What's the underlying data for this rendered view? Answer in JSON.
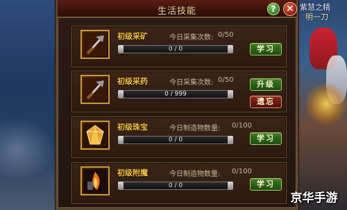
{
  "window": {
    "title": "生活技能",
    "help_label": "?",
    "close_label": "✕"
  },
  "background": {
    "npc_title": "紫慧之精",
    "npc_name": "明一刀"
  },
  "skills": [
    {
      "name": "初级采矿",
      "icon": "pickaxe-icon",
      "count_label": "今日采集次数:",
      "count_value": "0/50",
      "progress_text": "0 / 0",
      "progress": 0,
      "buttons": [
        {
          "label": "学习",
          "kind": "learn"
        }
      ]
    },
    {
      "name": "初级采药",
      "icon": "herb-sickle-icon",
      "count_label": "今日采集次数:",
      "count_value": "0/50",
      "progress_text": "0 / 999",
      "progress": 0,
      "buttons": [
        {
          "label": "升级",
          "kind": "upgrade"
        },
        {
          "label": "遗忘",
          "kind": "forget"
        }
      ]
    },
    {
      "name": "初级珠宝",
      "icon": "gem-icon",
      "count_label": "今日制造物数量:",
      "count_value": "0/100",
      "progress_text": "0 / 0",
      "progress": 0,
      "buttons": [
        {
          "label": "学习",
          "kind": "learn"
        }
      ]
    },
    {
      "name": "初级附魔",
      "icon": "enchant-flame-icon",
      "count_label": "今日制造物数量:",
      "count_value": "0/100",
      "progress_text": "0 / 0",
      "progress": 0,
      "buttons": [
        {
          "label": "学习",
          "kind": "learn"
        }
      ]
    }
  ],
  "watermark": "京华手游"
}
